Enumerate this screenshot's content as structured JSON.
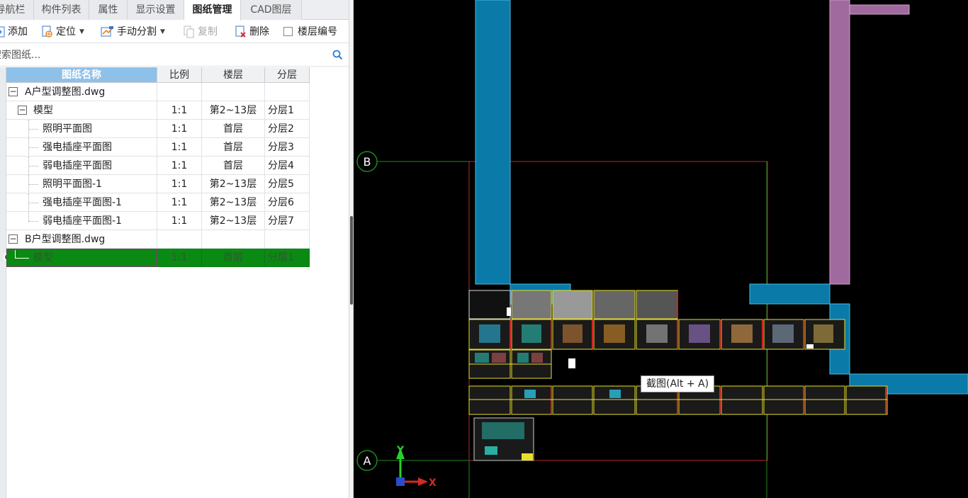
{
  "tabs": [
    {
      "label": "导航栏"
    },
    {
      "label": "构件列表"
    },
    {
      "label": "属性"
    },
    {
      "label": "显示设置"
    },
    {
      "label": "图纸管理"
    },
    {
      "label": "CAD图层"
    }
  ],
  "toolbar": {
    "add": "添加",
    "locate": "定位",
    "split": "手动分割",
    "copy": "复制",
    "delete": "删除",
    "floor_number": "楼层编号"
  },
  "search": {
    "placeholder": "搜索图纸..."
  },
  "table": {
    "headers": [
      "图纸名称",
      "比例",
      "楼层",
      "分层"
    ],
    "rows": [
      {
        "name": "A户型调整图.dwg",
        "scale": "",
        "floor": "",
        "layer": ""
      },
      {
        "name": "模型",
        "scale": "1:1",
        "floor": "第2~13层",
        "layer": "分层1"
      },
      {
        "name": "照明平面图",
        "scale": "1:1",
        "floor": "首层",
        "layer": "分层2"
      },
      {
        "name": "强电插座平面图",
        "scale": "1:1",
        "floor": "首层",
        "layer": "分层3"
      },
      {
        "name": "弱电插座平面图",
        "scale": "1:1",
        "floor": "首层",
        "layer": "分层4"
      },
      {
        "name": "照明平面图-1",
        "scale": "1:1",
        "floor": "第2~13层",
        "layer": "分层5"
      },
      {
        "name": "强电插座平面图-1",
        "scale": "1:1",
        "floor": "第2~13层",
        "layer": "分层6"
      },
      {
        "name": "弱电插座平面图-1",
        "scale": "1:1",
        "floor": "第2~13层",
        "layer": "分层7"
      },
      {
        "name": "B户型调整图.dwg",
        "scale": "",
        "floor": "",
        "layer": ""
      },
      {
        "name": "模型",
        "scale": "1:1",
        "floor": "首层",
        "layer": "分层1"
      }
    ]
  },
  "canvas": {
    "axis_b": "B",
    "axis_a": "A",
    "y_label": "Y",
    "x_label": "X",
    "tooltip": "截图(Alt + A)"
  },
  "colors": {
    "selected_row": "#0a8a12",
    "column_blue": "#0a7aa8",
    "column_purple": "#a06a9e",
    "boundary_red": "#b8282c",
    "grid_green": "#1e8a1e",
    "sheet_yellow": "#e8e02a"
  }
}
